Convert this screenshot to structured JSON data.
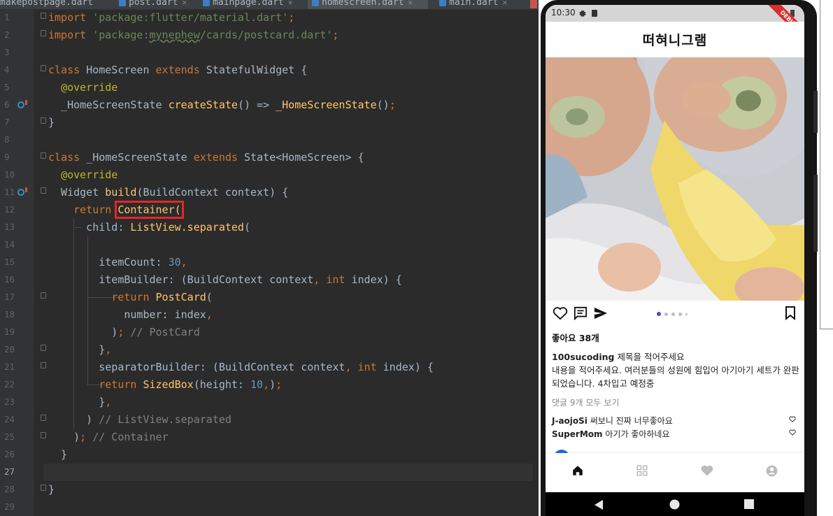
{
  "ide": {
    "tabs": [
      {
        "label": "makepostpage.dart"
      },
      {
        "label": "post.dart"
      },
      {
        "label": "mainpage.dart"
      },
      {
        "label": "homescreen.dart",
        "active": true
      },
      {
        "label": "main.dart"
      }
    ],
    "line_numbers": [
      "1",
      "2",
      "3",
      "4",
      "5",
      "6",
      "7",
      "8",
      "9",
      "10",
      "11",
      "12",
      "13",
      "14",
      "15",
      "16",
      "17",
      "18",
      "19",
      "20",
      "21",
      "22",
      "23",
      "24",
      "25",
      "26",
      "27",
      "28",
      "29"
    ],
    "current_line": 27,
    "highlighted_token": "Container("
  },
  "app": {
    "status_time": "10:30",
    "debug_banner": "DEBUG",
    "title": "떠혀니그램",
    "likes": "좋아요 38개",
    "post_user": "100sucoding",
    "post_title": "제목을 적어주세요",
    "post_body": "내용을 적어주세요. 여러분들의 성원에 힘입어 아기아기 세트가 완판되었습니다. 4차입고 예정중",
    "view_all_comments": "댓글 9개 모두 보기",
    "comments": [
      {
        "user": "J-aojoSi",
        "text": "써보니 진짜 너무좋아요"
      },
      {
        "user": "SuperMom",
        "text": "아기가 좋아하네요"
      }
    ],
    "carousel": {
      "count": 5,
      "active": 0
    },
    "accent_color": "#5b47c9",
    "icons": [
      "heart-outline-icon",
      "comment-icon",
      "send-icon",
      "bookmark-icon",
      "home-icon",
      "grid-icon",
      "heart-icon",
      "account-icon"
    ]
  }
}
